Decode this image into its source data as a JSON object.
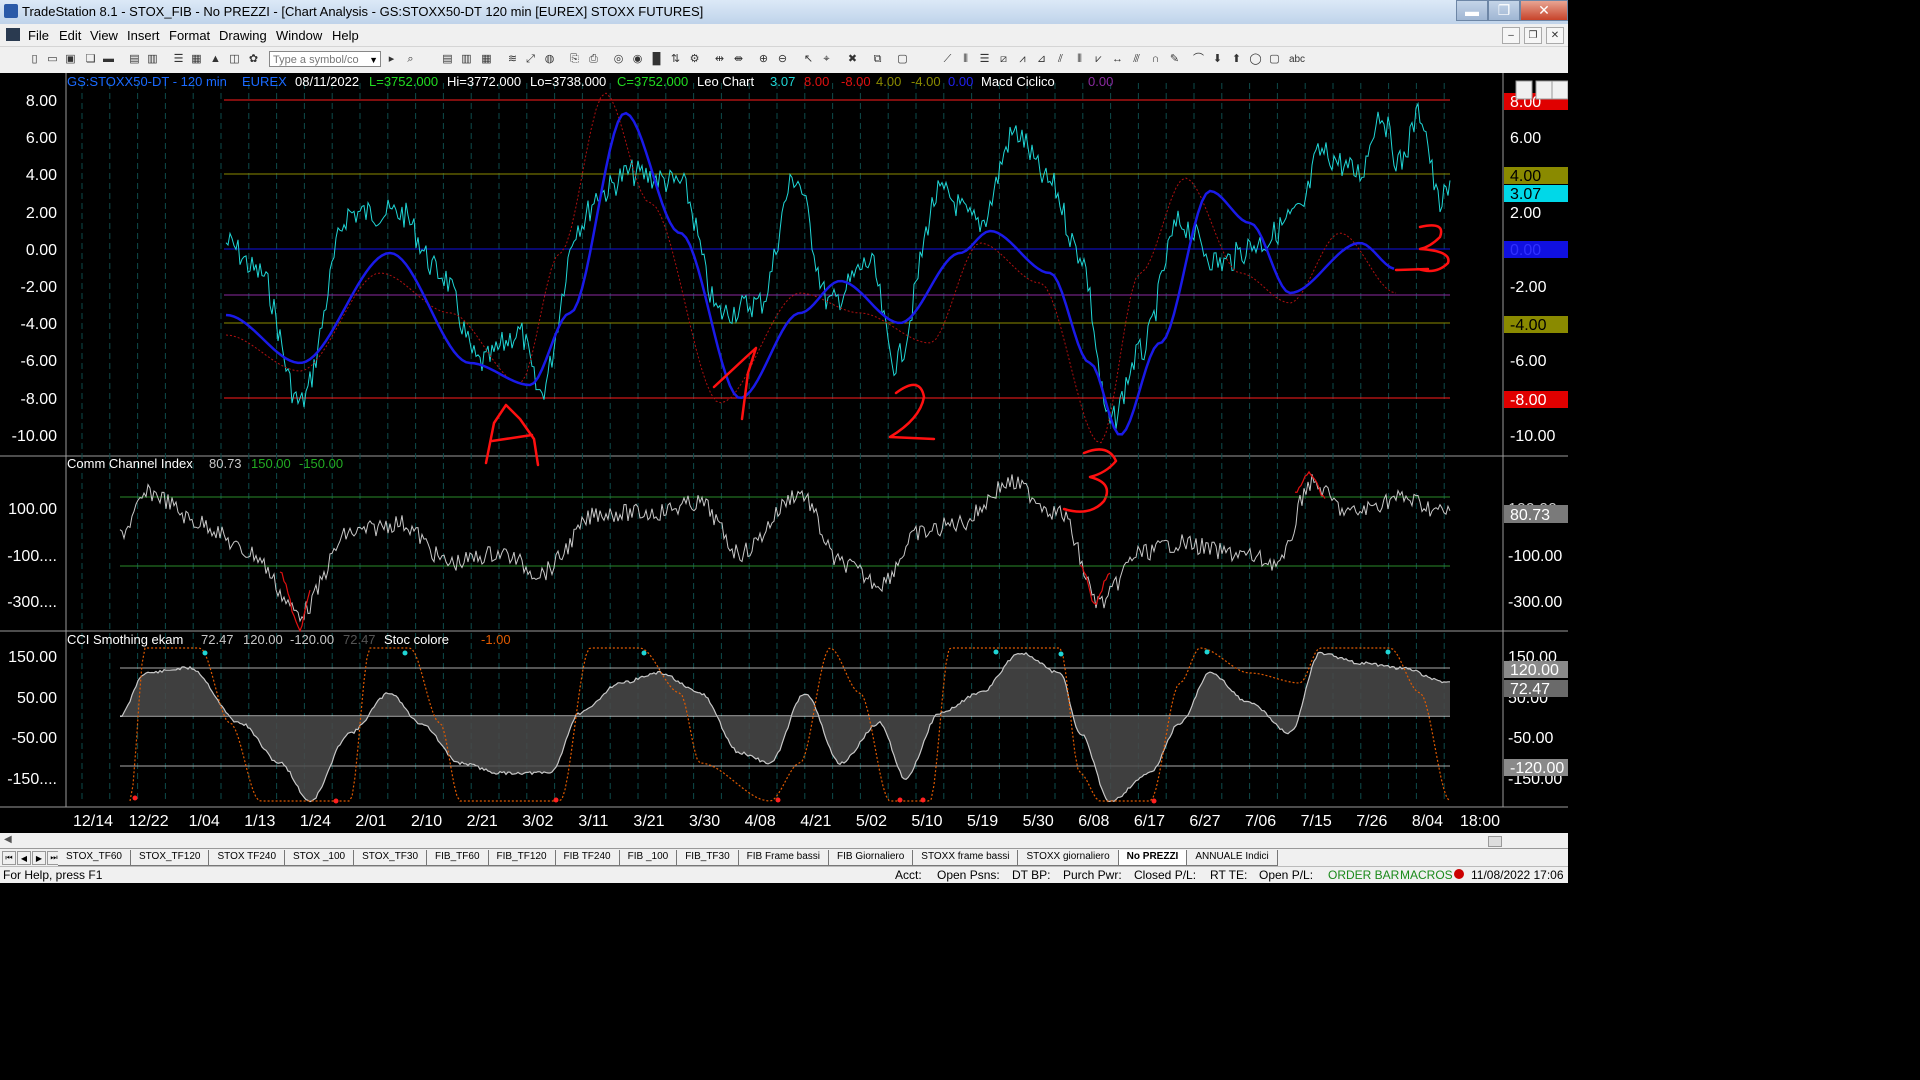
{
  "window": {
    "title": "TradeStation 8.1 - STOX_FIB - No PREZZI - [Chart Analysis - GS:STOXX50-DT  120 min  [EUREX] STOXX FUTURES]",
    "min": "▬",
    "max": "❐",
    "close": "✕"
  },
  "menu": [
    "File",
    "Edit",
    "View",
    "Insert",
    "Format",
    "Drawing",
    "Window",
    "Help"
  ],
  "toolbar": {
    "symbol_placeholder": "Type a symbol/co",
    "text_tool": "abc"
  },
  "header": {
    "symbol": "GS:STOXX50-DT - 120 min",
    "exchange": "EUREX",
    "date": "08/11/2022",
    "low_last": "L=3752.000",
    "hi": "Hi=3772.000",
    "lo": "Lo=3738.000",
    "close": "C=3752.000",
    "study1": "Leo Chart",
    "v1": "3.07",
    "v2": "8.00",
    "v3": "-8.00",
    "v4": "4.00",
    "v5": "-4.00",
    "v6": "0.00",
    "study2": "Macd Ciclico",
    "v7": "0.00"
  },
  "pane1": {
    "yticks": [
      "8.00",
      "6.00",
      "4.00",
      "2.00",
      "0.00",
      "-2.00",
      "-4.00",
      "-6.00",
      "-8.00",
      "-10.00"
    ],
    "right_labels": [
      {
        "text": "8.00",
        "bg": "#e00000"
      },
      {
        "text": "4.00",
        "bg": "#8a8a00"
      },
      {
        "text": "3.07",
        "bg": "#00d8e8"
      },
      {
        "text": "0.00",
        "bg": "#1010e0"
      },
      {
        "text": "-4.00",
        "bg": "#8a8a00"
      },
      {
        "text": "-8.00",
        "bg": "#e00000"
      }
    ],
    "annotations": [
      "A",
      "1",
      "2",
      "3",
      "3"
    ]
  },
  "pane2": {
    "title": "Comm Channel Index",
    "v1": "80.73",
    "v2": "150.00",
    "v3": "-150.00",
    "yticks": [
      "100.00",
      "-100....",
      "-300...."
    ],
    "right_ticks": [
      "100.00",
      "-100.00",
      "-300.00"
    ],
    "right_value": "80.73"
  },
  "pane3": {
    "title": "CCI Smothing ekam",
    "v1": "72.47",
    "v2": "120.00",
    "v3": "-120.00",
    "v4": "72.47",
    "study2": "Stoc colore",
    "v5": "-1.00",
    "yticks": [
      "150.00",
      "50.00",
      "-50.00",
      "-150...."
    ],
    "right_ticks": [
      "150.00",
      "50.00",
      "-50.00",
      "-150.00"
    ],
    "right_labels": [
      "120.00",
      "72.47",
      "-120.00"
    ]
  },
  "xaxis": [
    "12/14",
    "12/22",
    "1/04",
    "1/13",
    "1/24",
    "2/01",
    "2/10",
    "2/21",
    "3/02",
    "3/11",
    "3/21",
    "3/30",
    "4/08",
    "4/21",
    "5/02",
    "5/10",
    "5/19",
    "5/30",
    "6/08",
    "6/17",
    "6/27",
    "7/06",
    "7/15",
    "7/26",
    "8/04",
    "18:00"
  ],
  "tabs": [
    "STOX_TF60",
    "STOX_TF120",
    "STOX TF240",
    "STOX _100",
    "STOX_TF30",
    "FIB_TF60",
    "FIB_TF120",
    "FIB TF240",
    "FIB _100",
    "FIB_TF30",
    "FIB Frame bassi",
    "FIB Giornaliero",
    "STOXX frame bassi",
    "STOXX giornaliero",
    "No PREZZI",
    "ANNUALE Indici"
  ],
  "active_tab": "No PREZZI",
  "status": {
    "help": "For Help, press F1",
    "acct": "Acct:",
    "open_psns": "Open Psns:",
    "dt_bp": "DT BP:",
    "purch_pwr": "Purch Pwr:",
    "closed_pl": "Closed P/L:",
    "rt_te": "RT TE:",
    "open_pl": "Open P/L:",
    "order_bar": "ORDER BAR",
    "macros": "MACROS",
    "datetime": "11/08/2022 17:06"
  }
}
